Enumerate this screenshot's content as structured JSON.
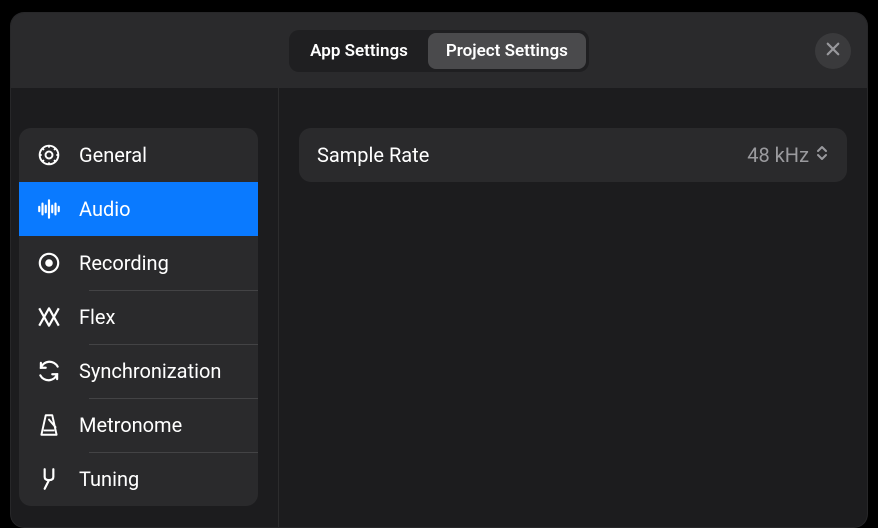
{
  "header": {
    "tabs": [
      {
        "id": "app-settings",
        "label": "App Settings",
        "active": false
      },
      {
        "id": "project-settings",
        "label": "Project Settings",
        "active": true
      }
    ]
  },
  "sidebar": {
    "items": [
      {
        "id": "general",
        "label": "General",
        "icon": "gear-icon",
        "active": false
      },
      {
        "id": "audio",
        "label": "Audio",
        "icon": "waveform-icon",
        "active": true
      },
      {
        "id": "recording",
        "label": "Recording",
        "icon": "record-icon",
        "active": false
      },
      {
        "id": "flex",
        "label": "Flex",
        "icon": "flex-icon",
        "active": false
      },
      {
        "id": "synchronization",
        "label": "Synchronization",
        "icon": "sync-icon",
        "active": false
      },
      {
        "id": "metronome",
        "label": "Metronome",
        "icon": "metronome-icon",
        "active": false
      },
      {
        "id": "tuning",
        "label": "Tuning",
        "icon": "tuning-fork-icon",
        "active": false
      }
    ]
  },
  "main": {
    "settings": {
      "sample_rate": {
        "label": "Sample Rate",
        "value": "48 kHz"
      }
    }
  }
}
